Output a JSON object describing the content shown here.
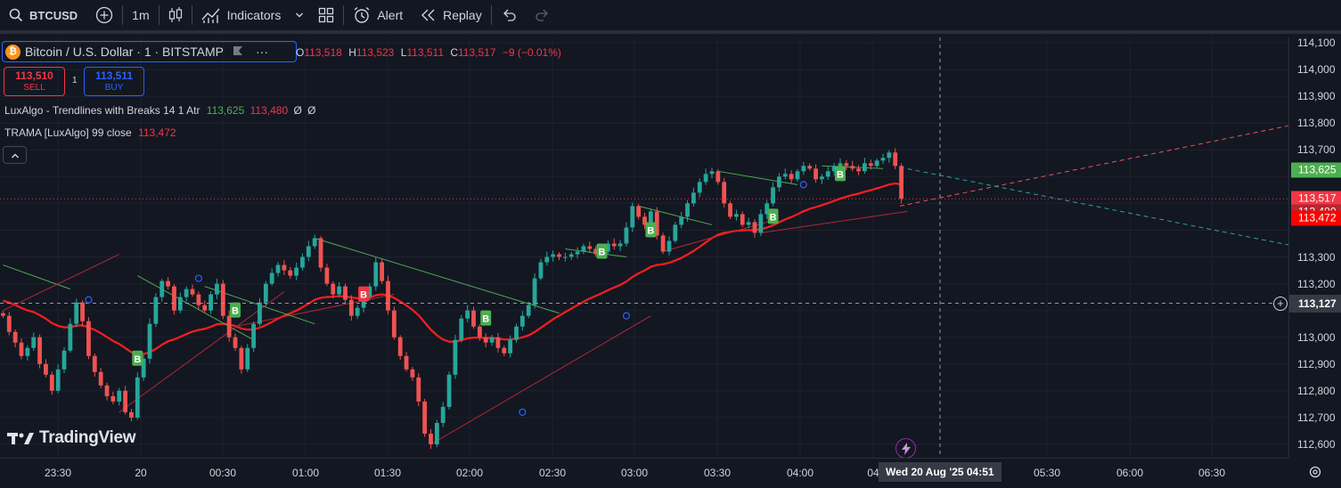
{
  "toolbar": {
    "symbol": "BTCUSD",
    "interval": "1m",
    "indicators_label": "Indicators",
    "alert_label": "Alert",
    "replay_label": "Replay",
    "icons": [
      "search-icon",
      "add-symbol-icon",
      "candles-icon",
      "indicators-icon",
      "chevron-down-icon",
      "layouts-icon",
      "alert-icon",
      "replay-icon",
      "undo-icon",
      "redo-icon"
    ]
  },
  "legend": {
    "title": "Bitcoin / U.S. Dollar · 1 · BITSTAMP",
    "more": "···",
    "ohlc": {
      "o_label": "O",
      "o": "113,518",
      "h_label": "H",
      "h": "113,523",
      "l_label": "L",
      "l": "113,511",
      "c_label": "C",
      "c": "113,517",
      "change": "−9 (−0.01%)"
    },
    "sell_price": "113,510",
    "sell_label": "SELL",
    "spread": "1",
    "buy_price": "113,511",
    "buy_label": "BUY",
    "indicator1": {
      "name": "LuxAlgo - Trendlines with Breaks 14 1 Atr",
      "v1": "113,625",
      "v2": "113,480",
      "v3": "Ø",
      "v4": "Ø"
    },
    "indicator2": {
      "name": "TRAMA [LuxAlgo] 99 close",
      "v1": "113,472"
    }
  },
  "brand": {
    "logo_text": "TradingView"
  },
  "price_axis": {
    "ticks": [
      "114,100",
      "114,000",
      "113,900",
      "113,800",
      "113,700",
      "113,300",
      "113,200",
      "113,000",
      "112,900",
      "112,800",
      "112,700",
      "112,600"
    ],
    "tags": [
      {
        "value": "113,625",
        "color": "#4caf50"
      },
      {
        "value": "113,517",
        "color": "#f23645"
      },
      {
        "value": "113,480",
        "color": "#b22833"
      },
      {
        "value": "113,472",
        "color": "#ff0000"
      }
    ],
    "crosshair_value": "113,127"
  },
  "time_axis": {
    "ticks": [
      "23:30",
      "20",
      "00:30",
      "01:00",
      "01:30",
      "02:00",
      "02:30",
      "03:00",
      "03:30",
      "04:00",
      "04",
      "05:30",
      "06:00",
      "06:30"
    ],
    "crosshair_label": "Wed 20 Aug '25   04:51"
  },
  "chart_data": {
    "type": "candlestick",
    "symbol": "BTCUSD",
    "interval": "1m",
    "price_range": [
      112550,
      114120
    ],
    "last_price": 113517,
    "crosshair_price": 113127,
    "series": [
      {
        "name": "TRAMA [LuxAlgo] 99 close",
        "last": 113472,
        "color": "#ff1e1e"
      },
      {
        "name": "LuxAlgo - Trendlines with Breaks 14 1 Atr",
        "upper": 113625,
        "lower": 113480
      }
    ],
    "closes": [
      113080,
      113020,
      112980,
      112930,
      112960,
      113000,
      112900,
      112860,
      112800,
      112880,
      112950,
      113050,
      113130,
      113060,
      112930,
      112870,
      112820,
      112780,
      112760,
      112800,
      112720,
      112700,
      112850,
      112920,
      113050,
      113150,
      113210,
      113190,
      113100,
      113150,
      113180,
      113160,
      113120,
      113100,
      113160,
      113200,
      113080,
      113000,
      112960,
      112880,
      112960,
      113050,
      113130,
      113200,
      113240,
      113270,
      113250,
      113230,
      113260,
      113300,
      113340,
      113370,
      113260,
      113200,
      113160,
      113190,
      113140,
      113080,
      113110,
      113150,
      113190,
      113280,
      113210,
      113100,
      113000,
      112930,
      112880,
      112850,
      112760,
      112640,
      112600,
      112680,
      112740,
      112860,
      112990,
      113070,
      113100,
      113040,
      113000,
      112980,
      113000,
      112960,
      112940,
      112990,
      113040,
      113080,
      113120,
      113220,
      113280,
      113300,
      113310,
      113300,
      113300,
      113310,
      113320,
      113340,
      113330,
      113310,
      113320,
      113350,
      113340,
      113350,
      113410,
      113490,
      113450,
      113420,
      113470,
      113380,
      113320,
      113360,
      113420,
      113450,
      113500,
      113540,
      113580,
      113610,
      113620,
      113580,
      113500,
      113450,
      113460,
      113420,
      113430,
      113390,
      113460,
      113500,
      113560,
      113600,
      113610,
      113590,
      113620,
      113640,
      113630,
      113590,
      113600,
      113620,
      113640,
      113650,
      113640,
      113630,
      113620,
      113650,
      113640,
      113660,
      113670,
      113690,
      113640,
      113517
    ],
    "markers": [
      {
        "label": "B",
        "type": "bullish-break",
        "price": 112920
      },
      {
        "label": "B",
        "type": "bullish-break",
        "price": 113100
      },
      {
        "label": "B",
        "type": "bearish-break",
        "price": 113160
      },
      {
        "label": "B",
        "type": "bullish-break",
        "price": 113070
      },
      {
        "label": "B",
        "type": "bullish-break",
        "price": 113320
      },
      {
        "label": "B",
        "type": "bullish-break",
        "price": 113400
      },
      {
        "label": "B",
        "type": "bullish-break",
        "price": 113450
      },
      {
        "label": "B",
        "type": "bullish-break",
        "price": 113610
      }
    ],
    "grid": true
  }
}
